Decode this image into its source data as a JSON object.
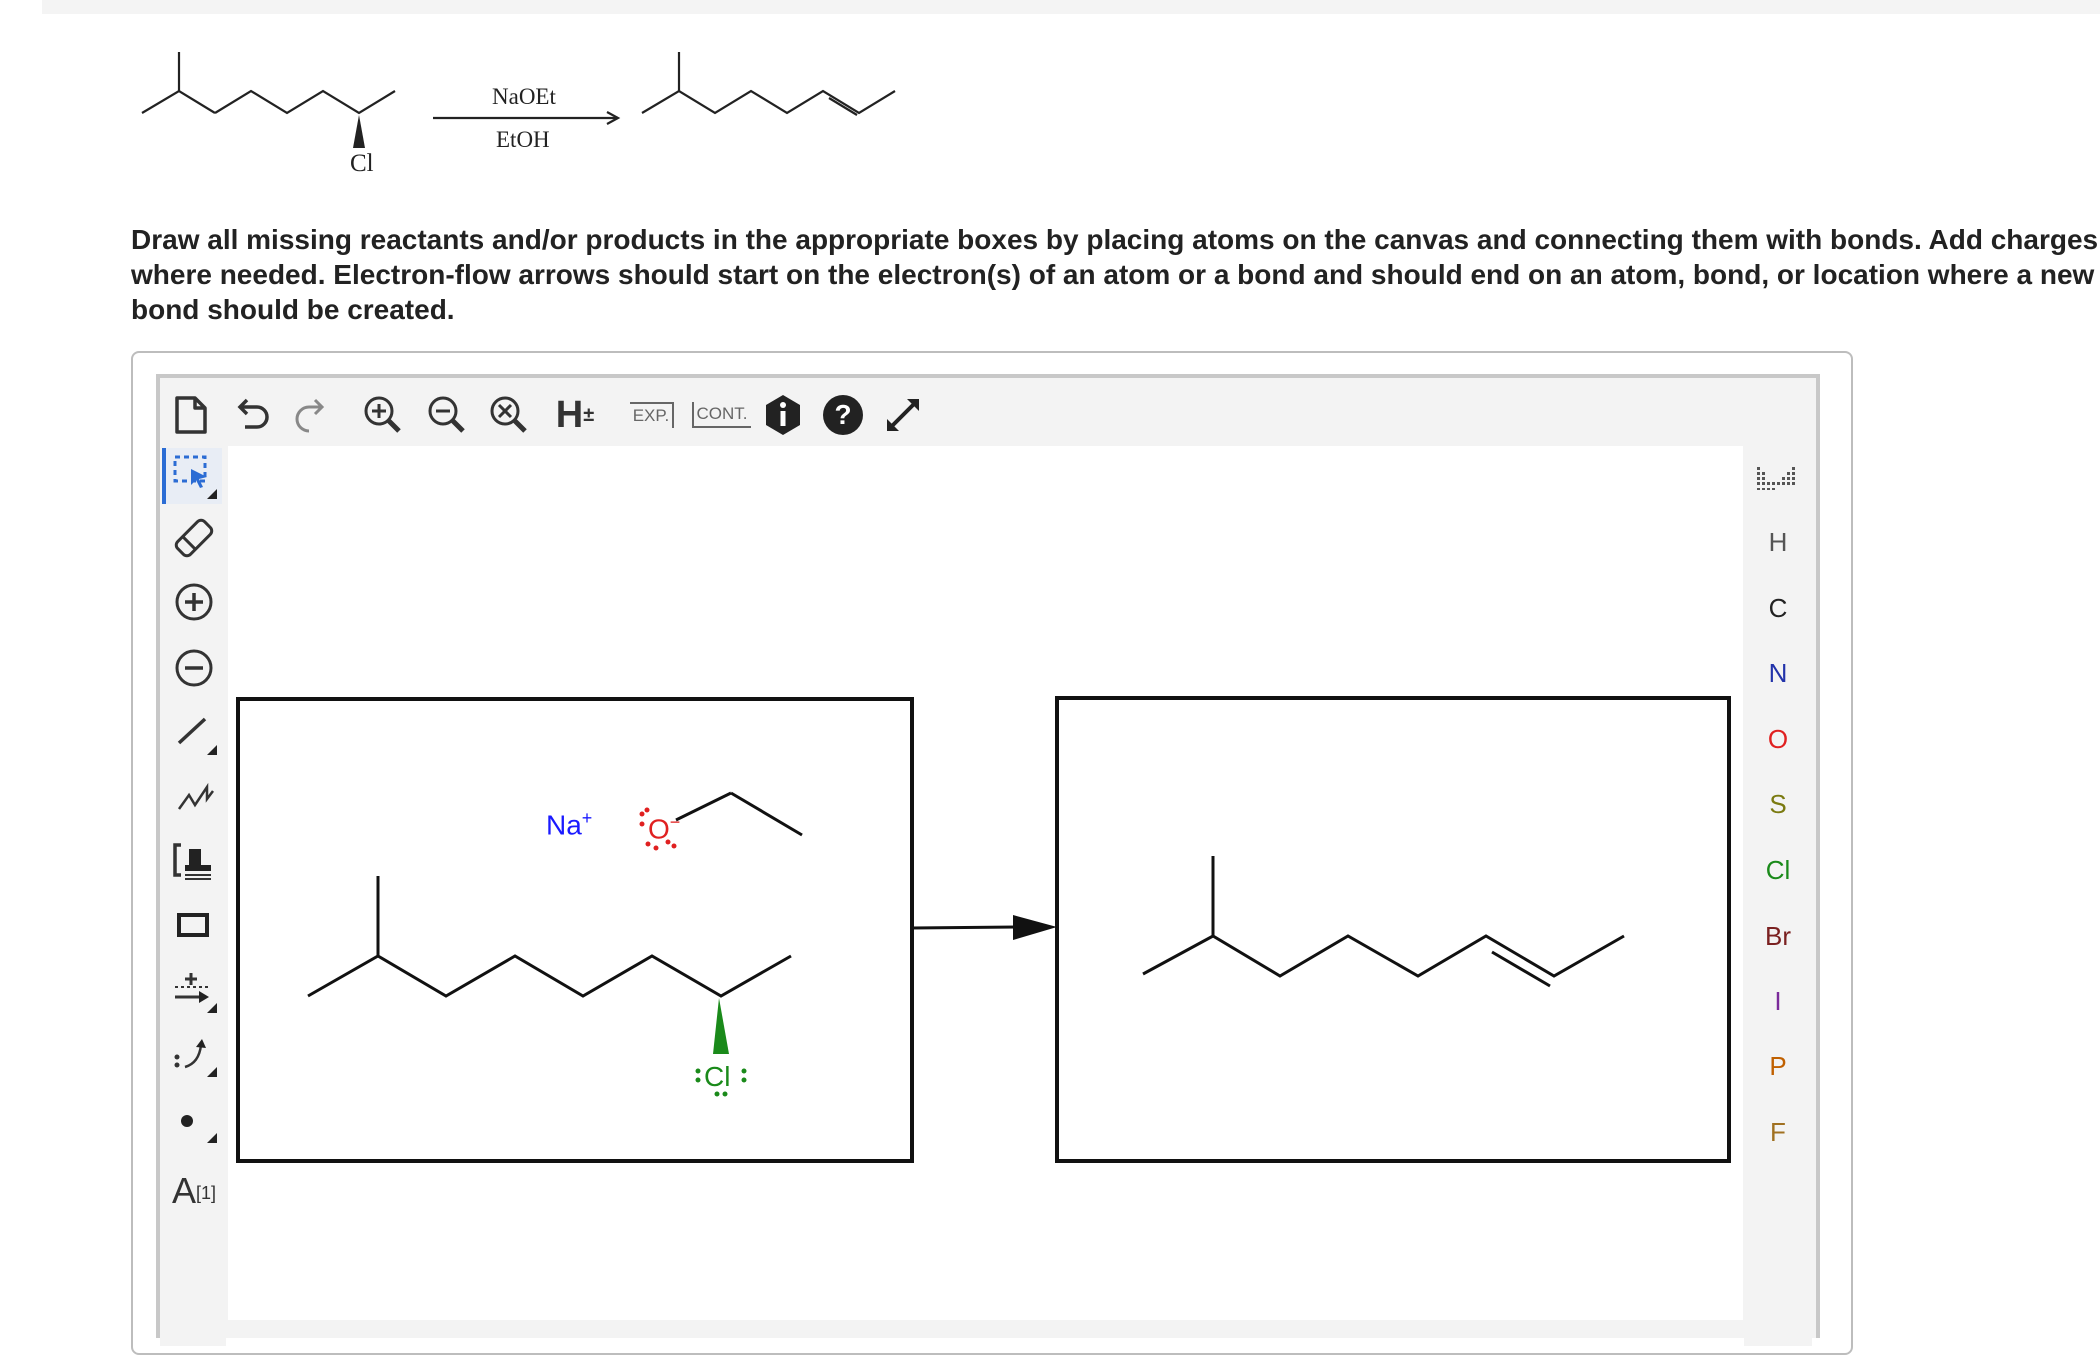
{
  "reaction_scheme": {
    "reagent": "NaOEt",
    "solvent": "EtOH",
    "leaving_group": "Cl"
  },
  "instructions": {
    "line1": "Draw all missing reactants and/or products in the appropriate boxes by placing atoms on the canvas and connecting them with bonds. Add charges",
    "line2": "where needed. Electron-flow arrows should start on the electron(s) of an atom or a bond and should end on an atom, bond, or location where a new",
    "line3": "bond should be created."
  },
  "top_toolbar": {
    "tools": [
      "new-document",
      "undo",
      "redo",
      "zoom-in",
      "zoom-out",
      "zoom-reset",
      "explicit-hydrogens",
      "expand",
      "contract",
      "info",
      "help",
      "fullscreen"
    ],
    "h_label": "H",
    "h_sup": "±",
    "exp_label": "EXP.",
    "cont_label": "CONT."
  },
  "left_toolbar": {
    "tools": [
      "select",
      "erase",
      "positive-charge",
      "negative-charge",
      "single-bond",
      "chain",
      "bracket",
      "rectangle",
      "reaction-arrow",
      "electron-flow-arrow",
      "radical",
      "atom-label"
    ],
    "atom_label_text": "A",
    "atom_label_sup": "[1]"
  },
  "right_toolbar": {
    "elements": [
      {
        "symbol": "H",
        "color": "#555555"
      },
      {
        "symbol": "C",
        "color": "#222222"
      },
      {
        "symbol": "N",
        "color": "#2233aa"
      },
      {
        "symbol": "O",
        "color": "#e02020"
      },
      {
        "symbol": "S",
        "color": "#7a7a10"
      },
      {
        "symbol": "Cl",
        "color": "#1a8a1a"
      },
      {
        "symbol": "Br",
        "color": "#7a2020"
      },
      {
        "symbol": "I",
        "color": "#7a2a9a"
      },
      {
        "symbol": "P",
        "color": "#c06000"
      },
      {
        "symbol": "F",
        "color": "#a07020"
      }
    ]
  },
  "canvas": {
    "reactant_box": {
      "sodium_label": "Na",
      "sodium_charge": "+",
      "oxygen_label": "O",
      "oxygen_charge": "−",
      "chlorine_label": "Cl"
    }
  },
  "colors": {
    "accent_blue": "#2b6cd4",
    "sodium": "#1a1aff",
    "oxygen": "#e02020",
    "chlorine": "#1a8a1a"
  }
}
